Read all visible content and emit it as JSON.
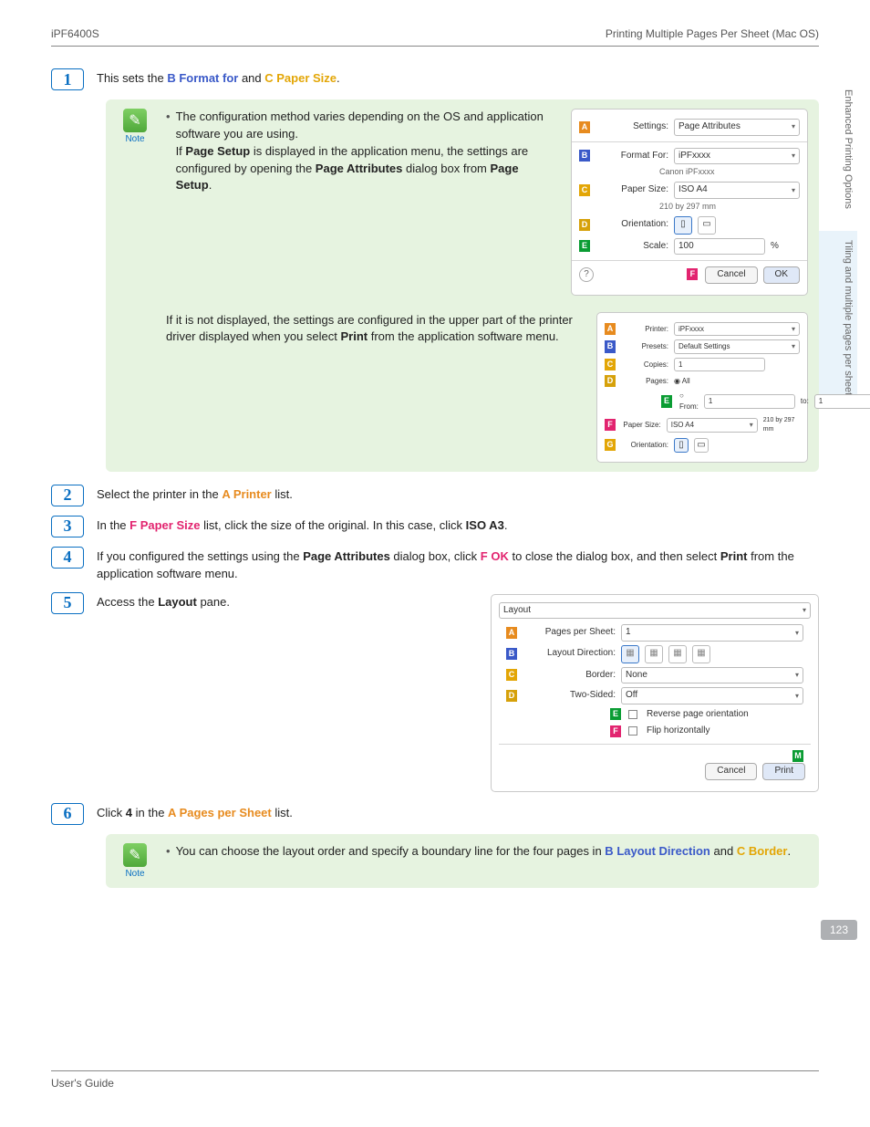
{
  "header": {
    "left": "iPF6400S",
    "right": "Printing Multiple Pages Per Sheet (Mac OS)"
  },
  "side": {
    "tab1": "Enhanced Printing Options",
    "tab2": "Tiling and multiple pages per sheet"
  },
  "pagenum": "123",
  "steps": {
    "s1": {
      "pre": "This sets the ",
      "b_label": "B",
      "b_text": "Format for",
      "mid": " and ",
      "c_label": "C",
      "c_text": "Paper Size",
      "end": "."
    },
    "s2": {
      "pre": "Select the printer in the ",
      "a_label": "A",
      "a_text": "Printer",
      "end": " list."
    },
    "s3": {
      "pre": "In the ",
      "f_label": "F",
      "f_text": "Paper Size",
      "mid": " list, click the size of the original. In this case, click ",
      "bold": "ISO A3",
      "end": "."
    },
    "s4": {
      "pre": "If you configured the settings using the ",
      "b1": "Page Attributes",
      "mid1": " dialog box, click ",
      "f_label": "F",
      "f_text": "OK",
      "mid2": " to close the dialog box, and then select ",
      "b2": "Print",
      "end": " from the application software menu."
    },
    "s5": {
      "pre": "Access the ",
      "b1": "Layout",
      "end": " pane."
    },
    "s6": {
      "pre": "Click ",
      "b1": "4",
      "mid": " in the ",
      "a_label": "A",
      "a_text": "Pages per Sheet",
      "end": " list."
    }
  },
  "note1": {
    "icon_label": "Note",
    "line1a": "The configuration method varies depending on the OS and application software you are using.",
    "line1b_pre": "If ",
    "line1b_bold1": "Page Setup",
    "line1b_mid1": " is displayed in the application menu, the settings are configured by opening the ",
    "line1b_bold2": "Page Attributes",
    "line1b_mid2": " dialog box from ",
    "line1b_bold3": "Page Setup",
    "line1b_end": ".",
    "para2_pre": "If it is not displayed, the settings are configured in the upper part of the printer driver displayed when you select ",
    "para2_bold": "Print",
    "para2_end": " from the application software menu."
  },
  "note2": {
    "icon_label": "Note",
    "line_pre": "You can choose the layout order and specify a boundary line for the four pages in ",
    "b_label": "B",
    "b_text": "Layout Direction",
    "mid": " and ",
    "c_label": "C",
    "c_text": "Border",
    "end": "."
  },
  "dialog1": {
    "settings_label": "Settings:",
    "settings_val": "Page Attributes",
    "format_label": "Format For:",
    "format_val": "iPFxxxx",
    "format_sub": "Canon iPFxxxx",
    "paper_label": "Paper Size:",
    "paper_val": "ISO A4",
    "paper_sub": "210 by 297 mm",
    "orient_label": "Orientation:",
    "scale_label": "Scale:",
    "scale_val": "100",
    "scale_unit": "%",
    "cancel": "Cancel",
    "ok": "OK"
  },
  "dialog2": {
    "printer_label": "Printer:",
    "printer_val": "iPFxxxx",
    "presets_label": "Presets:",
    "presets_val": "Default Settings",
    "copies_label": "Copies:",
    "copies_val": "1",
    "pages_label": "Pages:",
    "pages_all": "All",
    "pages_from": "From:",
    "pages_from_val": "1",
    "pages_to": "to:",
    "pages_to_val": "1",
    "paper_label": "Paper Size:",
    "paper_val": "ISO A4",
    "paper_dim": "210 by 297 mm",
    "orient_label": "Orientation:"
  },
  "layout_dialog": {
    "header": "Layout",
    "pps_label": "Pages per Sheet:",
    "pps_val": "1",
    "dir_label": "Layout Direction:",
    "border_label": "Border:",
    "border_val": "None",
    "two_label": "Two-Sided:",
    "two_val": "Off",
    "rev": "Reverse page orientation",
    "flip": "Flip horizontally",
    "cancel": "Cancel",
    "print": "Print"
  },
  "footer": {
    "left": "User's Guide",
    "right": ""
  }
}
